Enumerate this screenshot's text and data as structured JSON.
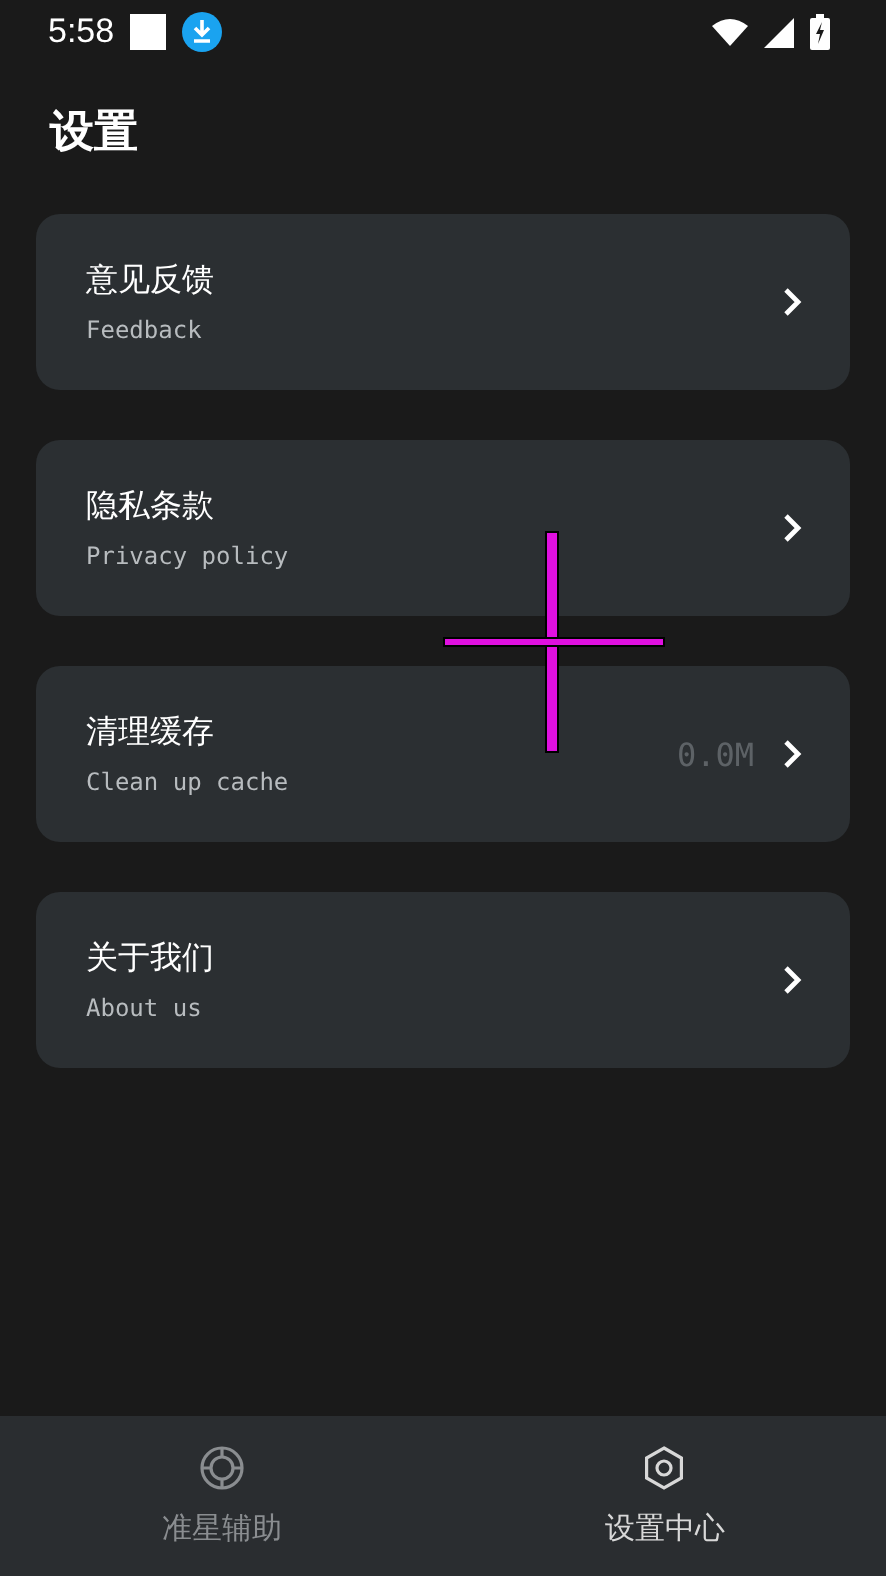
{
  "status_bar": {
    "time": "5:58"
  },
  "title": "设置",
  "items": [
    {
      "title": "意见反馈",
      "subtitle": "Feedback"
    },
    {
      "title": "隐私条款",
      "subtitle": "Privacy policy"
    },
    {
      "title": "清理缓存",
      "subtitle": "Clean up cache",
      "value": "0.0M"
    },
    {
      "title": "关于我们",
      "subtitle": "About us"
    }
  ],
  "crosshair": {
    "color": "#e010e0"
  },
  "tabs": [
    {
      "label": "准星辅助",
      "selected": false,
      "kind": "target"
    },
    {
      "label": "设置中心",
      "selected": true,
      "kind": "gear"
    }
  ]
}
